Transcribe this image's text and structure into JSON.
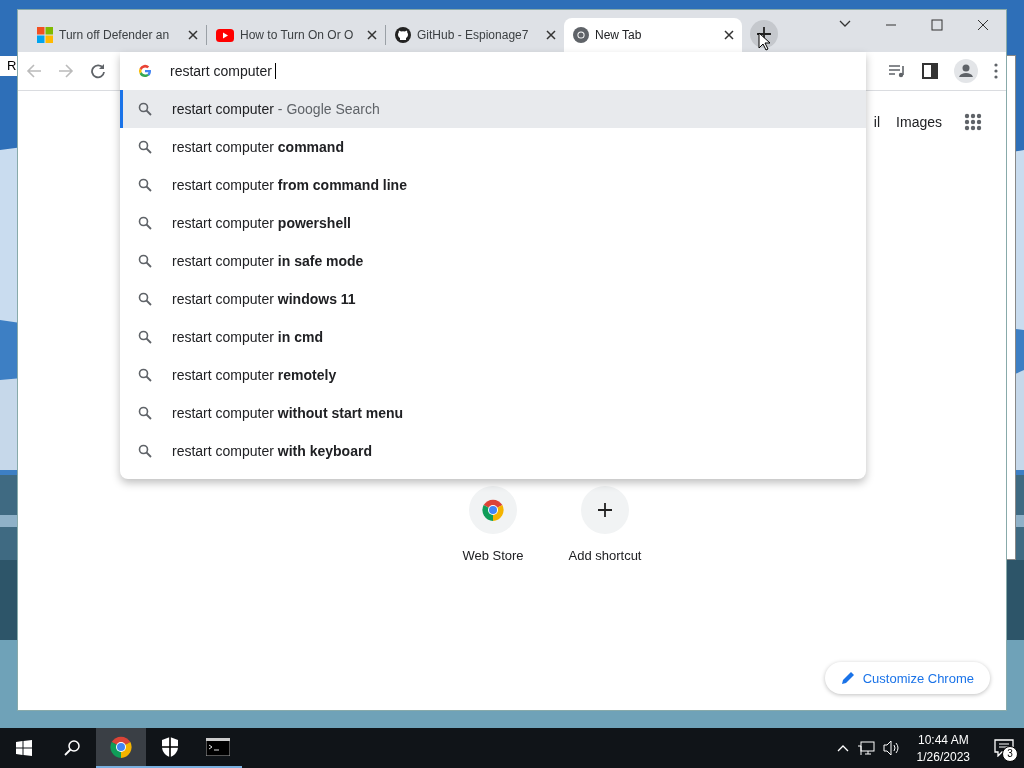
{
  "desktop": {
    "behind_window_text": "R"
  },
  "browser": {
    "tabs": [
      {
        "title": "Turn off Defender an",
        "kind": "microsoft",
        "selected": false
      },
      {
        "title": "How to Turn On Or O",
        "kind": "youtube",
        "selected": false
      },
      {
        "title": "GitHub - Espionage7",
        "kind": "github",
        "selected": false
      },
      {
        "title": "New Tab",
        "kind": "chrome",
        "selected": true
      }
    ],
    "address": {
      "value": "restart computer"
    },
    "suggestions": [
      {
        "text": "restart computer",
        "hint": "- Google Search",
        "selected": true
      },
      {
        "text": "restart computer **command**",
        "selected": false
      },
      {
        "text": "restart computer **from command line**",
        "selected": false
      },
      {
        "text": "restart computer **powershell**",
        "selected": false
      },
      {
        "text": "restart computer **in safe mode**",
        "selected": false
      },
      {
        "text": "restart computer **windows 11**",
        "selected": false
      },
      {
        "text": "restart computer **in cmd**",
        "selected": false
      },
      {
        "text": "restart computer **remotely**",
        "selected": false
      },
      {
        "text": "restart computer **without start menu**",
        "selected": false
      },
      {
        "text": "restart computer **with keyboard**",
        "selected": false
      }
    ],
    "header_links": [
      "il",
      "Images"
    ],
    "shortcuts": [
      {
        "label": "Web Store",
        "kind": "chrome"
      },
      {
        "label": "Add shortcut",
        "kind": "plus"
      }
    ],
    "customize_button": "Customize Chrome"
  },
  "taskbar": {
    "apps": [
      {
        "kind": "chrome",
        "active": true
      },
      {
        "kind": "shield",
        "active": false
      },
      {
        "kind": "terminal",
        "active": false
      }
    ],
    "time": "10:44 AM",
    "date": "1/26/2023",
    "notifications": "3"
  }
}
